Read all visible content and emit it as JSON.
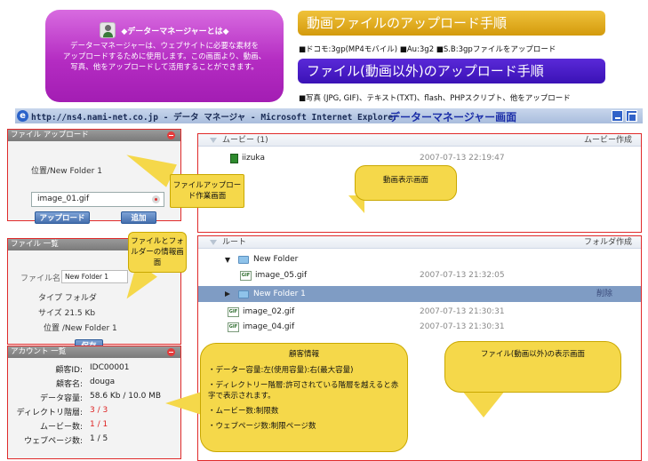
{
  "intro": {
    "title": "◆データーマネージャーとは◆",
    "body_line1": "データーマネージャーは、ウェブサイトに必要な素材を",
    "body_line2": "アップロードするために使用します。この画面より、動画、",
    "body_line3": "写真、他をアップロードして活用することができます。"
  },
  "procedures": {
    "movie_title": "動画ファイルのアップロード手順",
    "movie_note": "■ドコモ:3gp(MP4モバイル) ■Au:3g2 ■S.B:3gpファイルをアップロード",
    "file_title": "ファイル(動画以外)のアップロード手順",
    "file_note": "■写真 (JPG, GIF)、テキスト(TXT)、flash、PHPスクリプト、他をアップロード"
  },
  "window": {
    "title": "http://ns4.nami-net.co.jp - データ マネージャ - Microsoft Internet Explorer",
    "caption": "データーマネージャー画面"
  },
  "upload_panel": {
    "title": "ファイル アップロード",
    "location": "位置/New Folder 1",
    "file_value": "image_01.gif",
    "upload_label": "アップロード",
    "add_label": "追加"
  },
  "info_panel": {
    "title": "ファイル 一覧",
    "name_label": "ファイル名",
    "name_value": "New Folder 1",
    "type_line": "タイプ フォルダ",
    "size_line": "サイズ 21.5 Kb",
    "location_line": "位置 /New Folder 1",
    "save_label": "保存"
  },
  "account_panel": {
    "title": "アカウント 一覧",
    "id_label": "顧客ID:",
    "id_value": "IDC00001",
    "name_label": "顧客名:",
    "name_value": "douga",
    "capacity_label": "データ容量:",
    "capacity_value": "58.6 Kb / 10.0 MB",
    "dir_label": "ディレクトリ階層:",
    "dir_value": "3 / 3",
    "movie_label": "ムービー数:",
    "movie_value": "1 / 1",
    "web_label": "ウェブページ数:",
    "web_value": "1 / 5"
  },
  "movie_panel": {
    "header": "ムービー (1)",
    "action": "ムービー作成",
    "rows": [
      {
        "name": "iizuka",
        "date": "2007-07-13 22:19:47"
      }
    ]
  },
  "file_panel": {
    "header": "ルート",
    "action": "フォルダ作成",
    "rows": [
      {
        "name": "New Folder",
        "date": ""
      },
      {
        "name": "image_05.gif",
        "date": "2007-07-13 21:32:05"
      },
      {
        "name": "New Folder 1",
        "date": "",
        "action": "削除"
      },
      {
        "name": "image_02.gif",
        "date": "2007-07-13 21:30:31"
      },
      {
        "name": "image_04.gif",
        "date": "2007-07-13 21:30:31"
      }
    ]
  },
  "callouts": {
    "upload": "ファイルアップロード作業画面",
    "info": "ファイルとフォルダーの情報画面",
    "movie": "動画表示画面",
    "files": "ファイル(動画以外)の表示画面",
    "account_title": "顧客情報",
    "account_line1": "・データー容量:左(使用容量):右(最大容量)",
    "account_line2": "・ディレクトリー階層:許可されている階層を越えると赤字で表示されます。",
    "account_line3": "・ムービー数:制限数",
    "account_line4": "・ウェブページ数:制限ページ数"
  },
  "colors": {
    "panel_border": "#e02a2a",
    "selected_row": "#7f9cc4",
    "callout": "#f5d84a"
  }
}
